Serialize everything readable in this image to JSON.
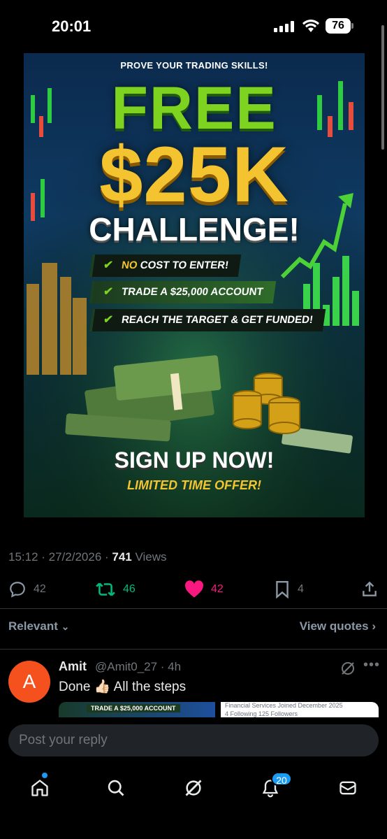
{
  "status_bar": {
    "time": "20:01",
    "battery": "76"
  },
  "post": {
    "image": {
      "tagline": "PROVE YOUR TRADING SKILLS!",
      "headline_1": "FREE",
      "headline_2": "$25K",
      "headline_3": "CHALLENGE!",
      "bullets": [
        {
          "prefix": "NO",
          "text": " COST TO ENTER!"
        },
        {
          "prefix": "",
          "text": "TRADE A $25,000 ACCOUNT"
        },
        {
          "prefix": "",
          "text": "REACH THE TARGET & GET FUNDED!"
        }
      ],
      "cta": "SIGN UP NOW!",
      "subcta": "LIMITED TIME OFFER!"
    },
    "timestamp": "15:12 · 27/2/2026 · ",
    "views_count": "741",
    "views_label": " Views",
    "actions": {
      "replies": "42",
      "reposts": "46",
      "likes": "42",
      "bookmarks": "4"
    },
    "colors": {
      "repost": "#00ba7c",
      "like": "#f91880",
      "accent": "#1d9bf0"
    }
  },
  "replies_header": {
    "sort": "Relevant",
    "view_quotes": "View quotes"
  },
  "reply": {
    "avatar_letter": "A",
    "name": "Amit",
    "handle_time": "@Amit0_27 · 4h",
    "text": "Done 👍🏻 All the steps",
    "thumb_left_text": "TRADE A $25,000 ACCOUNT",
    "thumb_right_line1": "Financial Services    Joined December 2025",
    "thumb_right_line2": "4 Following    125 Followers"
  },
  "composer": {
    "placeholder": "Post your reply"
  },
  "tabbar": {
    "icons": [
      "home-icon",
      "search-icon",
      "grok-icon",
      "notifications-icon",
      "messages-icon"
    ],
    "notification_badge": "20"
  }
}
